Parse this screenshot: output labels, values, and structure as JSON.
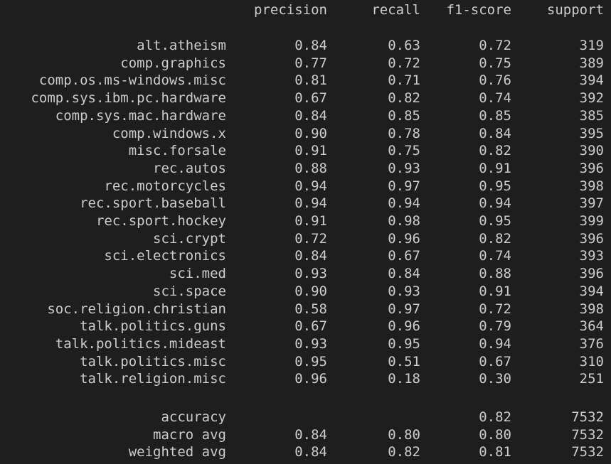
{
  "report": {
    "headers": {
      "precision": "precision",
      "recall": "recall",
      "f1": "f1-score",
      "support": "support"
    },
    "rows": [
      {
        "label": "alt.atheism",
        "precision": "0.84",
        "recall": "0.63",
        "f1": "0.72",
        "support": "319"
      },
      {
        "label": "comp.graphics",
        "precision": "0.77",
        "recall": "0.72",
        "f1": "0.75",
        "support": "389"
      },
      {
        "label": "comp.os.ms-windows.misc",
        "precision": "0.81",
        "recall": "0.71",
        "f1": "0.76",
        "support": "394"
      },
      {
        "label": "comp.sys.ibm.pc.hardware",
        "precision": "0.67",
        "recall": "0.82",
        "f1": "0.74",
        "support": "392"
      },
      {
        "label": "comp.sys.mac.hardware",
        "precision": "0.84",
        "recall": "0.85",
        "f1": "0.85",
        "support": "385"
      },
      {
        "label": "comp.windows.x",
        "precision": "0.90",
        "recall": "0.78",
        "f1": "0.84",
        "support": "395"
      },
      {
        "label": "misc.forsale",
        "precision": "0.91",
        "recall": "0.75",
        "f1": "0.82",
        "support": "390"
      },
      {
        "label": "rec.autos",
        "precision": "0.88",
        "recall": "0.93",
        "f1": "0.91",
        "support": "396"
      },
      {
        "label": "rec.motorcycles",
        "precision": "0.94",
        "recall": "0.97",
        "f1": "0.95",
        "support": "398"
      },
      {
        "label": "rec.sport.baseball",
        "precision": "0.94",
        "recall": "0.94",
        "f1": "0.94",
        "support": "397"
      },
      {
        "label": "rec.sport.hockey",
        "precision": "0.91",
        "recall": "0.98",
        "f1": "0.95",
        "support": "399"
      },
      {
        "label": "sci.crypt",
        "precision": "0.72",
        "recall": "0.96",
        "f1": "0.82",
        "support": "396"
      },
      {
        "label": "sci.electronics",
        "precision": "0.84",
        "recall": "0.67",
        "f1": "0.74",
        "support": "393"
      },
      {
        "label": "sci.med",
        "precision": "0.93",
        "recall": "0.84",
        "f1": "0.88",
        "support": "396"
      },
      {
        "label": "sci.space",
        "precision": "0.90",
        "recall": "0.93",
        "f1": "0.91",
        "support": "394"
      },
      {
        "label": "soc.religion.christian",
        "precision": "0.58",
        "recall": "0.97",
        "f1": "0.72",
        "support": "398"
      },
      {
        "label": "talk.politics.guns",
        "precision": "0.67",
        "recall": "0.96",
        "f1": "0.79",
        "support": "364"
      },
      {
        "label": "talk.politics.mideast",
        "precision": "0.93",
        "recall": "0.95",
        "f1": "0.94",
        "support": "376"
      },
      {
        "label": "talk.politics.misc",
        "precision": "0.95",
        "recall": "0.51",
        "f1": "0.67",
        "support": "310"
      },
      {
        "label": "talk.religion.misc",
        "precision": "0.96",
        "recall": "0.18",
        "f1": "0.30",
        "support": "251"
      }
    ],
    "summary": [
      {
        "label": "accuracy",
        "precision": "",
        "recall": "",
        "f1": "0.82",
        "support": "7532"
      },
      {
        "label": "macro avg",
        "precision": "0.84",
        "recall": "0.80",
        "f1": "0.80",
        "support": "7532"
      },
      {
        "label": "weighted avg",
        "precision": "0.84",
        "recall": "0.82",
        "f1": "0.81",
        "support": "7532"
      }
    ]
  },
  "theme": {
    "background": "#1e1e1e",
    "text": "#cccccc"
  }
}
